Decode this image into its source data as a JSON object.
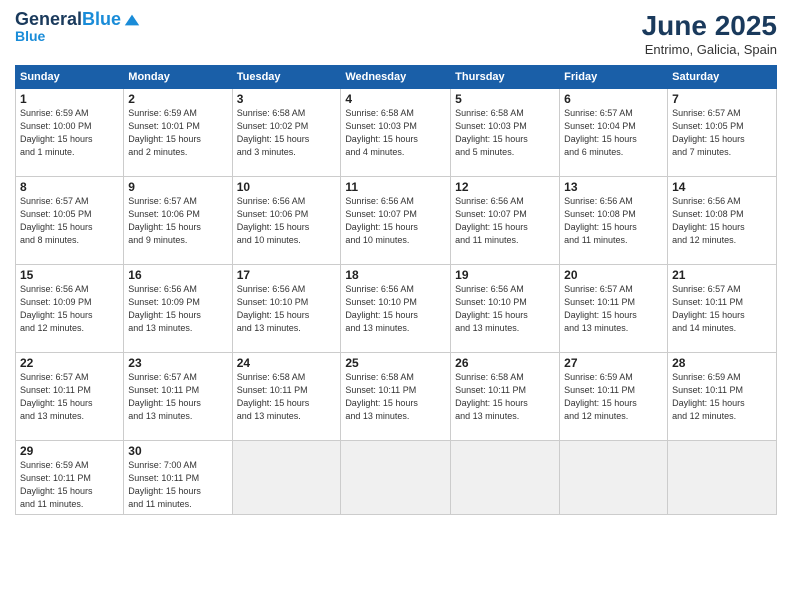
{
  "header": {
    "logo_line1": "General",
    "logo_line2": "Blue",
    "month": "June 2025",
    "location": "Entrimo, Galicia, Spain"
  },
  "weekdays": [
    "Sunday",
    "Monday",
    "Tuesday",
    "Wednesday",
    "Thursday",
    "Friday",
    "Saturday"
  ],
  "weeks": [
    [
      {
        "day": "1",
        "info": "Sunrise: 6:59 AM\nSunset: 10:00 PM\nDaylight: 15 hours\nand 1 minute."
      },
      {
        "day": "2",
        "info": "Sunrise: 6:59 AM\nSunset: 10:01 PM\nDaylight: 15 hours\nand 2 minutes."
      },
      {
        "day": "3",
        "info": "Sunrise: 6:58 AM\nSunset: 10:02 PM\nDaylight: 15 hours\nand 3 minutes."
      },
      {
        "day": "4",
        "info": "Sunrise: 6:58 AM\nSunset: 10:03 PM\nDaylight: 15 hours\nand 4 minutes."
      },
      {
        "day": "5",
        "info": "Sunrise: 6:58 AM\nSunset: 10:03 PM\nDaylight: 15 hours\nand 5 minutes."
      },
      {
        "day": "6",
        "info": "Sunrise: 6:57 AM\nSunset: 10:04 PM\nDaylight: 15 hours\nand 6 minutes."
      },
      {
        "day": "7",
        "info": "Sunrise: 6:57 AM\nSunset: 10:05 PM\nDaylight: 15 hours\nand 7 minutes."
      }
    ],
    [
      {
        "day": "8",
        "info": "Sunrise: 6:57 AM\nSunset: 10:05 PM\nDaylight: 15 hours\nand 8 minutes."
      },
      {
        "day": "9",
        "info": "Sunrise: 6:57 AM\nSunset: 10:06 PM\nDaylight: 15 hours\nand 9 minutes."
      },
      {
        "day": "10",
        "info": "Sunrise: 6:56 AM\nSunset: 10:06 PM\nDaylight: 15 hours\nand 10 minutes."
      },
      {
        "day": "11",
        "info": "Sunrise: 6:56 AM\nSunset: 10:07 PM\nDaylight: 15 hours\nand 10 minutes."
      },
      {
        "day": "12",
        "info": "Sunrise: 6:56 AM\nSunset: 10:07 PM\nDaylight: 15 hours\nand 11 minutes."
      },
      {
        "day": "13",
        "info": "Sunrise: 6:56 AM\nSunset: 10:08 PM\nDaylight: 15 hours\nand 11 minutes."
      },
      {
        "day": "14",
        "info": "Sunrise: 6:56 AM\nSunset: 10:08 PM\nDaylight: 15 hours\nand 12 minutes."
      }
    ],
    [
      {
        "day": "15",
        "info": "Sunrise: 6:56 AM\nSunset: 10:09 PM\nDaylight: 15 hours\nand 12 minutes."
      },
      {
        "day": "16",
        "info": "Sunrise: 6:56 AM\nSunset: 10:09 PM\nDaylight: 15 hours\nand 13 minutes."
      },
      {
        "day": "17",
        "info": "Sunrise: 6:56 AM\nSunset: 10:10 PM\nDaylight: 15 hours\nand 13 minutes."
      },
      {
        "day": "18",
        "info": "Sunrise: 6:56 AM\nSunset: 10:10 PM\nDaylight: 15 hours\nand 13 minutes."
      },
      {
        "day": "19",
        "info": "Sunrise: 6:56 AM\nSunset: 10:10 PM\nDaylight: 15 hours\nand 13 minutes."
      },
      {
        "day": "20",
        "info": "Sunrise: 6:57 AM\nSunset: 10:11 PM\nDaylight: 15 hours\nand 13 minutes."
      },
      {
        "day": "21",
        "info": "Sunrise: 6:57 AM\nSunset: 10:11 PM\nDaylight: 15 hours\nand 14 minutes."
      }
    ],
    [
      {
        "day": "22",
        "info": "Sunrise: 6:57 AM\nSunset: 10:11 PM\nDaylight: 15 hours\nand 13 minutes."
      },
      {
        "day": "23",
        "info": "Sunrise: 6:57 AM\nSunset: 10:11 PM\nDaylight: 15 hours\nand 13 minutes."
      },
      {
        "day": "24",
        "info": "Sunrise: 6:58 AM\nSunset: 10:11 PM\nDaylight: 15 hours\nand 13 minutes."
      },
      {
        "day": "25",
        "info": "Sunrise: 6:58 AM\nSunset: 10:11 PM\nDaylight: 15 hours\nand 13 minutes."
      },
      {
        "day": "26",
        "info": "Sunrise: 6:58 AM\nSunset: 10:11 PM\nDaylight: 15 hours\nand 13 minutes."
      },
      {
        "day": "27",
        "info": "Sunrise: 6:59 AM\nSunset: 10:11 PM\nDaylight: 15 hours\nand 12 minutes."
      },
      {
        "day": "28",
        "info": "Sunrise: 6:59 AM\nSunset: 10:11 PM\nDaylight: 15 hours\nand 12 minutes."
      }
    ],
    [
      {
        "day": "29",
        "info": "Sunrise: 6:59 AM\nSunset: 10:11 PM\nDaylight: 15 hours\nand 11 minutes."
      },
      {
        "day": "30",
        "info": "Sunrise: 7:00 AM\nSunset: 10:11 PM\nDaylight: 15 hours\nand 11 minutes."
      },
      {
        "day": "",
        "info": ""
      },
      {
        "day": "",
        "info": ""
      },
      {
        "day": "",
        "info": ""
      },
      {
        "day": "",
        "info": ""
      },
      {
        "day": "",
        "info": ""
      }
    ]
  ]
}
